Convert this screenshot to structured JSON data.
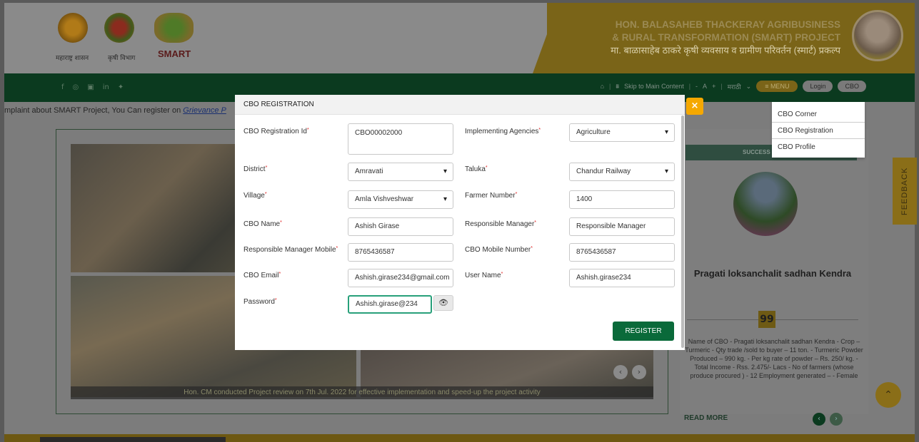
{
  "header": {
    "logo_captions": [
      "महाराष्ट्र शासन",
      "कृषी विभाग"
    ],
    "smart_logo_text": "SMART",
    "title_en_line1": "HON. BALASAHEB THACKERAY AGRIBUSINESS",
    "title_en_line2": "& RURAL TRANSFORMATION (SMART) PROJECT",
    "title_mr": "मा. बाळासाहेब ठाकरे कृषी व्यवसाय व ग्रामीण परिवर्तन (स्मार्ट) प्रकल्प"
  },
  "nav": {
    "social_icons": [
      "f",
      "◎",
      "▣",
      "in",
      "✦"
    ],
    "home_icon": "⌂",
    "sitemap_icon": "⩩",
    "skip_link": "Skip to Main Content",
    "font_minus": "-",
    "font_normal": "A",
    "font_plus": "+",
    "language": "मराठी",
    "menu_label": "≡ MENU",
    "login_label": "Login",
    "cbo_label": "CBO"
  },
  "dropdown": {
    "items": [
      "CBO Corner",
      "CBO Registration",
      "CBO Profile"
    ]
  },
  "notice": {
    "text": "mplaint about SMART Project, You Can register on ",
    "link": "Grievance P"
  },
  "gallery": {
    "caption": "Hon. CM conducted Project review on 7th Jul. 2022 for effective implementation and speed-up the project activity"
  },
  "story": {
    "heading": "SUCCESS S",
    "title": "Pragati loksanchalit sadhan Kendra",
    "quote_mark": "99",
    "text": "Name of CBO - Pragati loksanchalit sadhan Kendra - Crop – Turmeric - Qty trade /sold to buyer – 11 ton. - Turmeric Powder Produced – 990 kg. - Per kg rate of powder – Rs. 250/ kg. - Total Income - Rss. 2.475/- Lacs - No of farmers (whose produce procured ) - 12 Employment generated – - Female",
    "read_more": "READ MORE"
  },
  "feedback_label": "FEEDBACK",
  "scroll_top_icon": "⌃",
  "modal": {
    "title": "CBO REGISTRATION",
    "close_icon": "×",
    "fields": {
      "cbo_registration_id": {
        "label": "CBO Registration Id",
        "value": "CBO00002000"
      },
      "implementing_agencies": {
        "label": "Implementing Agencies",
        "value": "Agriculture"
      },
      "district": {
        "label": "District",
        "value": "Amravati"
      },
      "taluka": {
        "label": "Taluka",
        "value": "Chandur Railway"
      },
      "village": {
        "label": "Village",
        "value": "Amla Vishveshwar"
      },
      "farmer_number": {
        "label": "Farmer Number",
        "value": "1400"
      },
      "cbo_name": {
        "label": "CBO Name",
        "value": "Ashish Girase"
      },
      "responsible_manager": {
        "label": "Responsible Manager",
        "value": "Responsible Manager"
      },
      "responsible_manager_mobile": {
        "label": "Responsible Manager Mobile",
        "value": "8765436587"
      },
      "cbo_mobile_number": {
        "label": "CBO Mobile Number",
        "value": "8765436587"
      },
      "cbo_email": {
        "label": "CBO Email",
        "value": "Ashish.girase234@gmail.com"
      },
      "user_name": {
        "label": "User Name",
        "value": "Ashish.girase234"
      },
      "password": {
        "label": "Password",
        "value": "Ashish.girase@234"
      }
    },
    "required_mark": "*",
    "eye_icon": "👁",
    "register_label": "REGISTER"
  }
}
